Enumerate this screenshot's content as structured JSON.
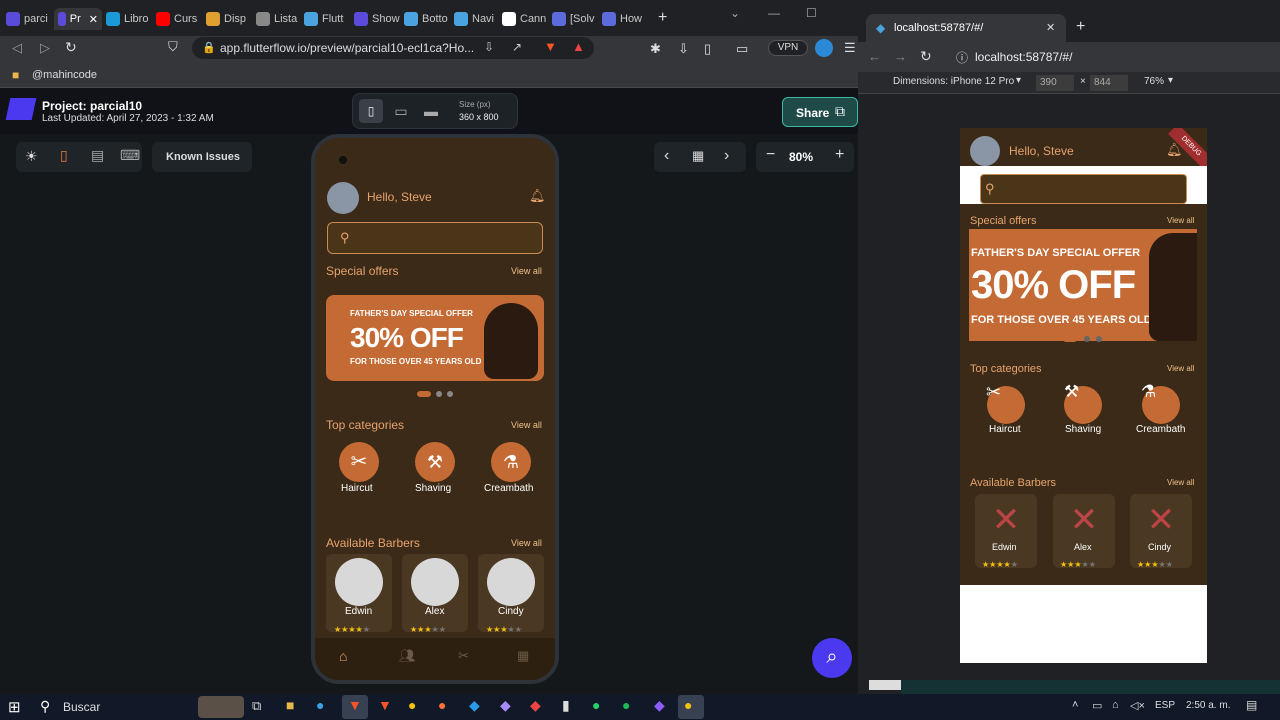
{
  "browser": {
    "tabs": [
      {
        "label": "parci",
        "color": "#5b4bdb"
      },
      {
        "label": "Pr",
        "color": "#5b4bdb",
        "active": true
      },
      {
        "label": "Libro",
        "color": "#1a9bd7"
      },
      {
        "label": "Curs",
        "color": "#ff0000"
      },
      {
        "label": "Disp",
        "color": "#e0a030"
      },
      {
        "label": "Lista",
        "color": "#888888"
      },
      {
        "label": "Flutt",
        "color": "#4aa3df"
      },
      {
        "label": "Show",
        "color": "#5b4bdb"
      },
      {
        "label": "Botto",
        "color": "#4aa3df"
      },
      {
        "label": "Navi",
        "color": "#4aa3df"
      },
      {
        "label": "Cann",
        "color": "#ffffff"
      },
      {
        "label": "[Solv",
        "color": "#5b6bdb"
      },
      {
        "label": "How",
        "color": "#5b6bdb"
      }
    ],
    "url": "app.flutterflow.io/preview/parcial10-ecl1ca?Ho...",
    "bookmark": "@mahincode",
    "vpn": "VPN"
  },
  "flutterflow": {
    "project_title": "Project: parcial10",
    "last_updated": "Last Updated: April 27, 2023 - 1:32 AM",
    "size_label": "Size (px)",
    "size_value": "360 x 800",
    "share": "Share",
    "known_issues": "Known Issues",
    "zoom": "80%"
  },
  "app": {
    "greeting": "Hello, Steve",
    "special_offers": "Special offers",
    "view_all": "View all",
    "banner_line1": "FATHER'S DAY SPECIAL OFFER",
    "banner_line2": "30% OFF",
    "banner_line3": "FOR THOSE OVER 45 YEARS OLD",
    "top_categories": "Top categories",
    "categories": [
      "Haircut",
      "Shaving",
      "Creambath"
    ],
    "available_barbers": "Available Barbers",
    "barbers": [
      {
        "name": "Edwin",
        "rating": 4
      },
      {
        "name": "Alex",
        "rating": 3
      },
      {
        "name": "Cindy",
        "rating": 3
      }
    ],
    "accent": "#c46a34",
    "bg": "#3a2a17"
  },
  "devtools": {
    "tab_title": "localhost:58787/#/",
    "url": "localhost:58787/#/",
    "dimensions_label": "Dimensions: iPhone 12 Pro",
    "width": "390",
    "height": "844",
    "zoom": "76%",
    "debug": "DEBUG"
  },
  "taskbar": {
    "search": "Buscar",
    "lang": "ESP",
    "time": "2:50 a. m."
  }
}
